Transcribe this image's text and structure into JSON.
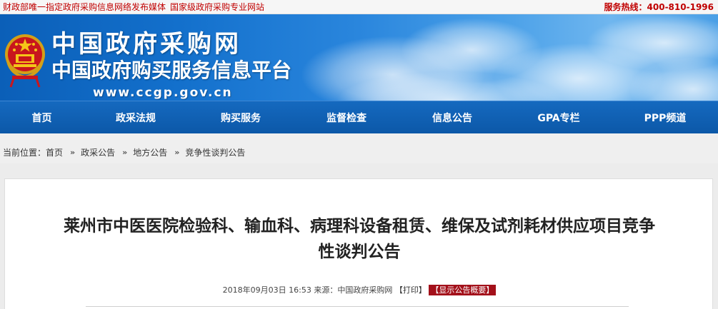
{
  "topbar": {
    "left_1": "财政部唯一指定政府采购信息网络发布媒体",
    "left_2": "国家级政府采购专业网站",
    "hotline": "服务热线：400-810-1996"
  },
  "banner": {
    "title_cn": "中国政府采购网",
    "subtitle_cn": "中国政府购买服务信息平台",
    "url": "www.ccgp.gov.cn"
  },
  "nav": {
    "items": [
      {
        "label": "首页"
      },
      {
        "label": "政采法规"
      },
      {
        "label": "购买服务"
      },
      {
        "label": "监督检查"
      },
      {
        "label": "信息公告"
      },
      {
        "label": "GPA专栏"
      },
      {
        "label": "PPP频道"
      }
    ]
  },
  "breadcrumb": {
    "prefix": "当前位置：",
    "items": [
      "首页",
      "政采公告",
      "地方公告",
      "竞争性谈判公告"
    ],
    "separator": "»"
  },
  "article": {
    "title_line1": "莱州市中医医院检验科、输血科、病理科设备租赁、维保及试剂耗材供应项目竞争",
    "title_line2": "性谈判公告",
    "date": "2018年09月03日",
    "time": "16:53",
    "source_label": "来源：",
    "source": "中国政府采购网",
    "print": "【打印】",
    "summary": "【显示公告概要】"
  },
  "colors": {
    "nav_bg": "#0c58a8",
    "accent_red": "#a3101a",
    "topbar_red": "#c00000"
  }
}
